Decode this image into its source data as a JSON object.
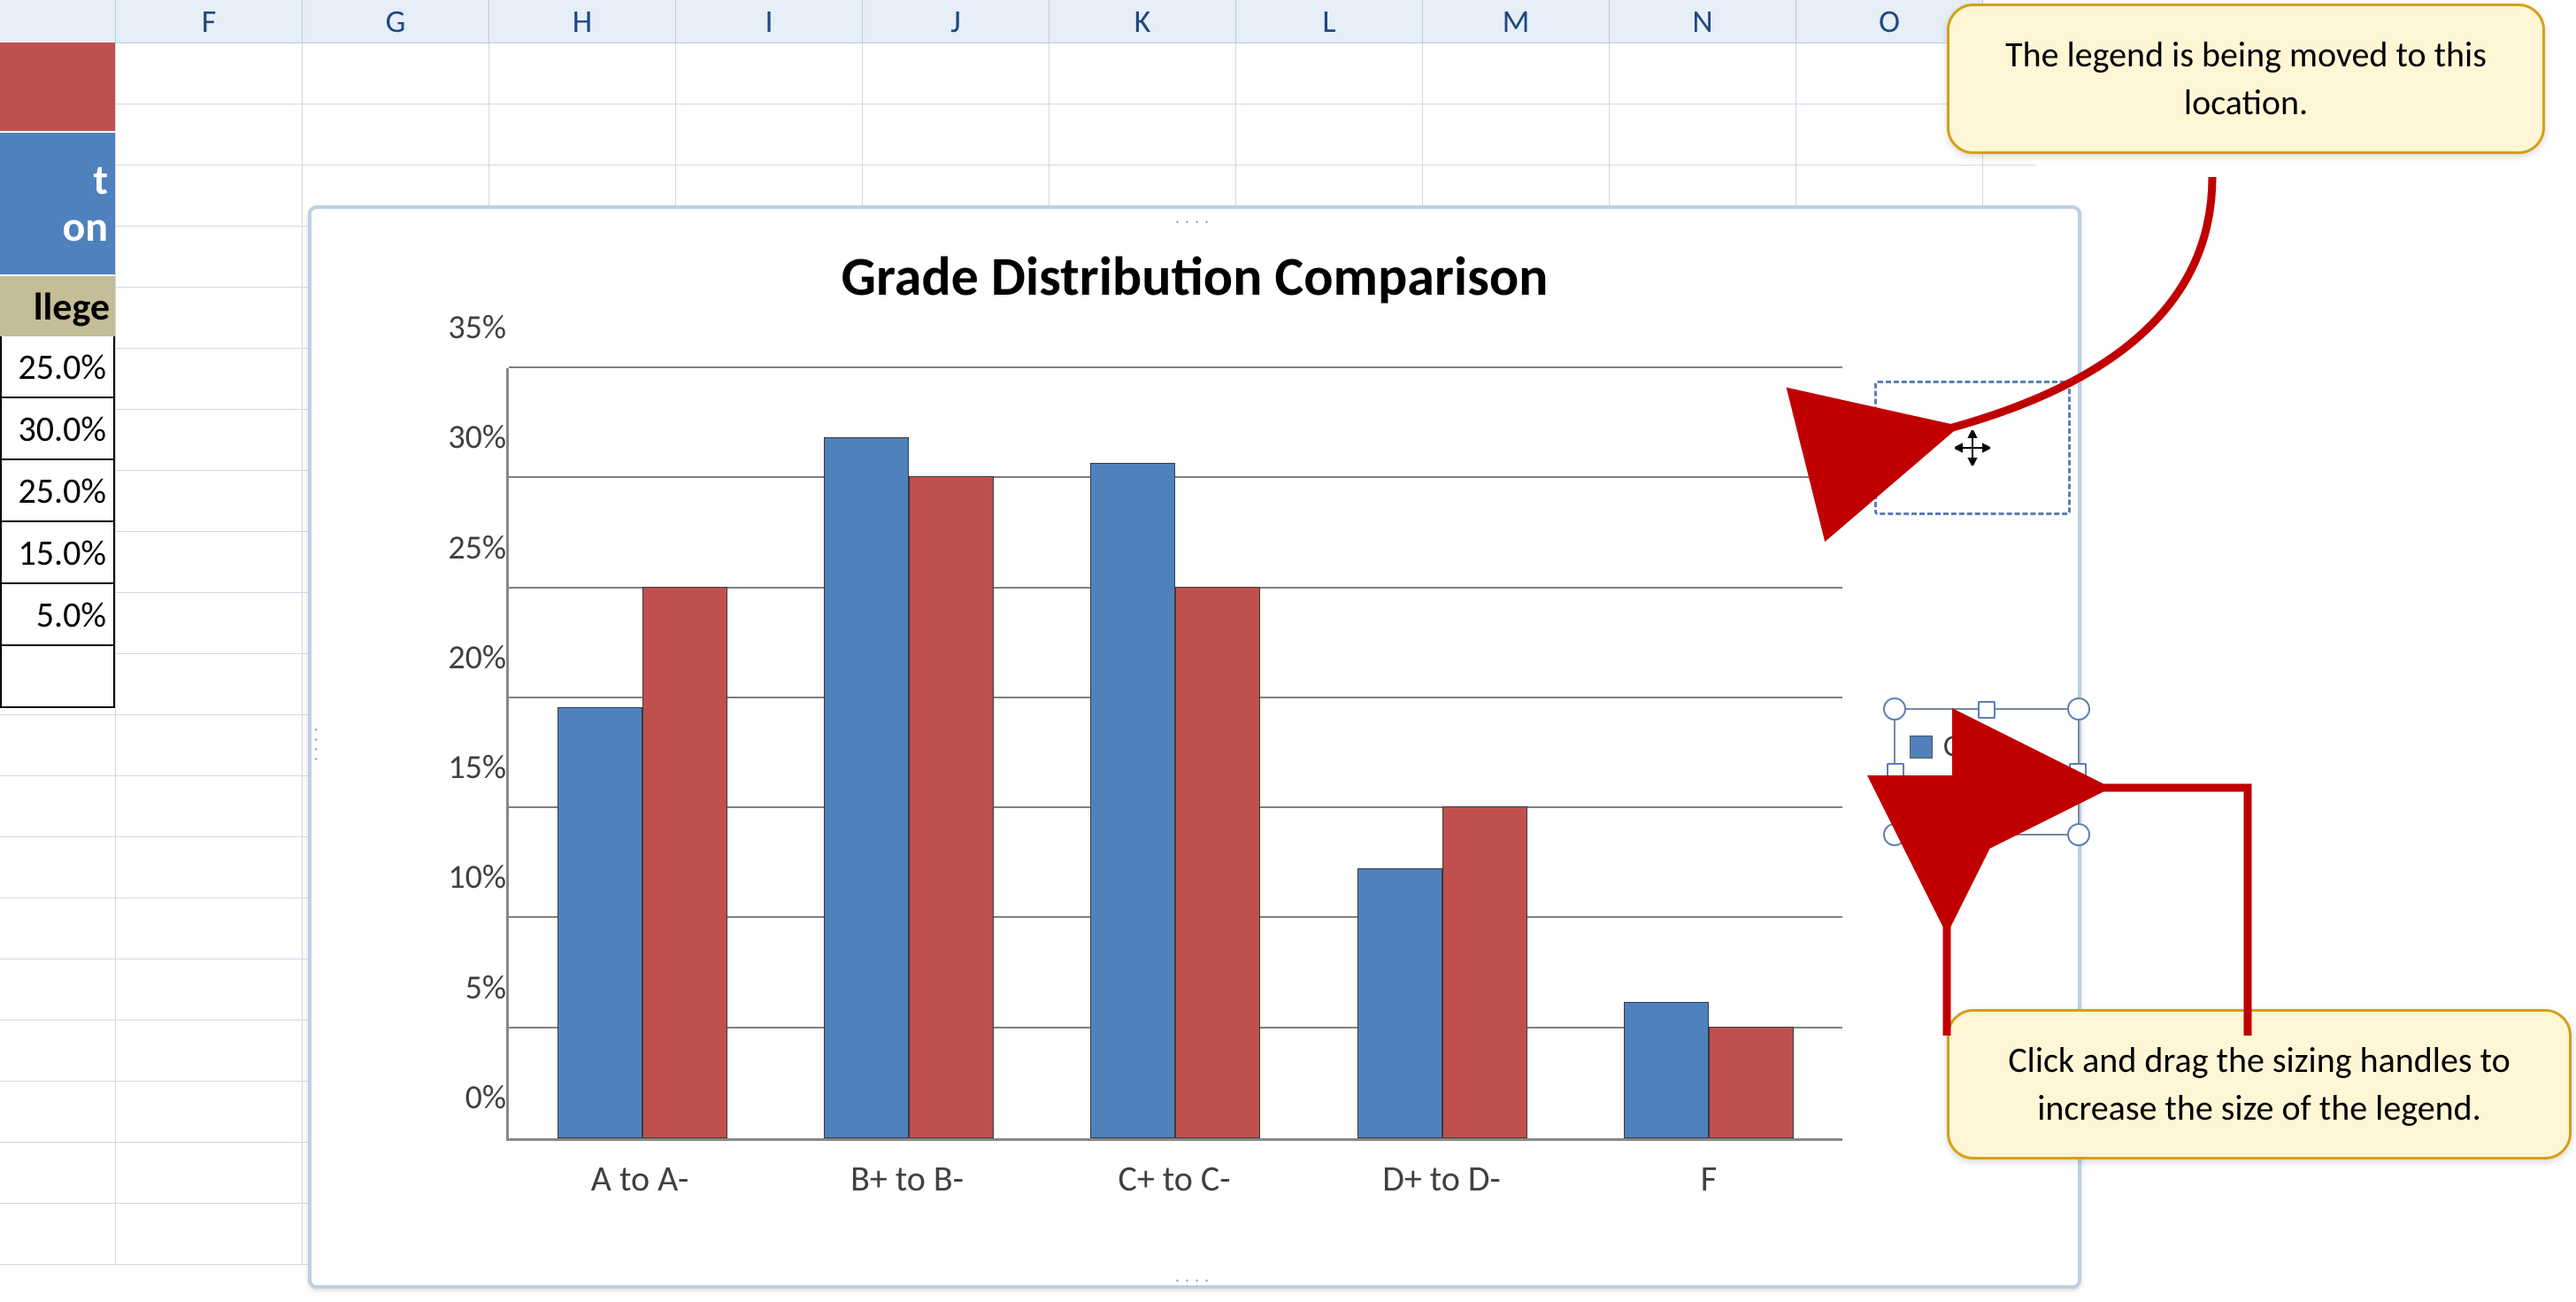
{
  "columns": [
    "F",
    "G",
    "H",
    "I",
    "J",
    "K",
    "L",
    "M",
    "N",
    "O"
  ],
  "left_partial": {
    "blue_lines": [
      "t",
      "on"
    ],
    "olive": "llege",
    "values": [
      "25.0%",
      "30.0%",
      "25.0%",
      "15.0%",
      "5.0%"
    ]
  },
  "chart_data": {
    "type": "bar",
    "title": "Grade Distribution Comparison",
    "categories": [
      "A to A-",
      "B+ to B-",
      "C+ to C-",
      "D+ to D-",
      "F"
    ],
    "series": [
      {
        "name": "Class",
        "values": [
          19.5,
          31.8,
          30.6,
          12.2,
          6.1
        ]
      },
      {
        "name": "College",
        "values": [
          25.0,
          30.0,
          25.0,
          15.0,
          5.0
        ]
      }
    ],
    "ylabel": "",
    "xlabel": "",
    "ylim": [
      0,
      35
    ],
    "yticks": [
      "0%",
      "5%",
      "10%",
      "15%",
      "20%",
      "25%",
      "30%",
      "35%"
    ],
    "legend_position": "right (being moved)"
  },
  "legend": {
    "items": [
      "Class",
      "College"
    ]
  },
  "callouts": {
    "c1": "The legend is being moved to this location.",
    "c2": "Click and drag the sizing handles to increase the size of the legend."
  }
}
